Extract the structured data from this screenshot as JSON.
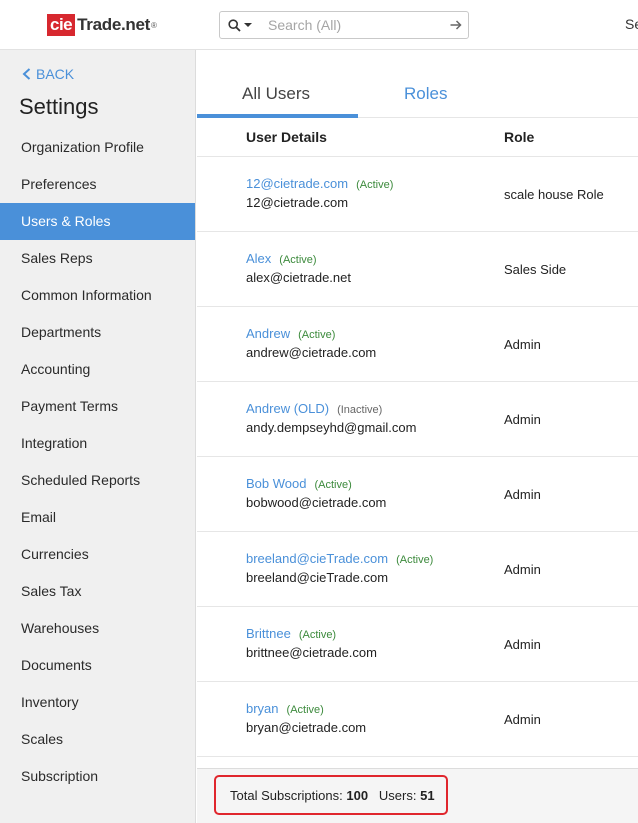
{
  "header": {
    "logo_box": "cie",
    "logo_rest": "Trade.net",
    "logo_reg": "®",
    "search_placeholder": "Search (All)",
    "cut_text": "Se"
  },
  "sidebar": {
    "back_label": "BACK",
    "title": "Settings",
    "items": [
      {
        "label": "Organization Profile"
      },
      {
        "label": "Preferences"
      },
      {
        "label": "Users & Roles",
        "active": true
      },
      {
        "label": "Sales Reps"
      },
      {
        "label": "Common Information"
      },
      {
        "label": "Departments"
      },
      {
        "label": "Accounting"
      },
      {
        "label": "Payment Terms"
      },
      {
        "label": "Integration"
      },
      {
        "label": "Scheduled Reports"
      },
      {
        "label": "Email"
      },
      {
        "label": "Currencies"
      },
      {
        "label": "Sales Tax"
      },
      {
        "label": "Warehouses"
      },
      {
        "label": "Documents"
      },
      {
        "label": "Inventory"
      },
      {
        "label": "Scales"
      },
      {
        "label": "Subscription"
      }
    ]
  },
  "tabs": {
    "all_users": "All Users",
    "roles": "Roles"
  },
  "table": {
    "col_user": "User Details",
    "col_role": "Role",
    "rows": [
      {
        "name": "12@cietrade.com",
        "status": "(Active)",
        "email": "12@cietrade.com",
        "role": "scale house Role"
      },
      {
        "name": "Alex",
        "status": "(Active)",
        "email": "alex@cietrade.net",
        "role": "Sales Side"
      },
      {
        "name": "Andrew",
        "status": "(Active)",
        "email": "andrew@cietrade.com",
        "role": "Admin"
      },
      {
        "name": "Andrew (OLD)",
        "status": "(Inactive)",
        "email": "andy.dempseyhd@gmail.com",
        "role": "Admin"
      },
      {
        "name": "Bob Wood",
        "status": "(Active)",
        "email": "bobwood@cietrade.com",
        "role": "Admin"
      },
      {
        "name": "breeland@cieTrade.com",
        "status": "(Active)",
        "email": "breeland@cieTrade.com",
        "role": "Admin"
      },
      {
        "name": "Brittnee",
        "status": "(Active)",
        "email": "brittnee@cietrade.com",
        "role": "Admin"
      },
      {
        "name": "bryan",
        "status": "(Active)",
        "email": "bryan@cietrade.com",
        "role": "Admin"
      }
    ]
  },
  "footer": {
    "subs_label": "Total Subscriptions:",
    "subs_value": "100",
    "users_label": "Users:",
    "users_value": "51"
  },
  "colors": {
    "accent": "#4a90d9",
    "brand_red": "#d7282f",
    "highlight_box": "#e0262d",
    "active_status": "#3c8a3c"
  }
}
